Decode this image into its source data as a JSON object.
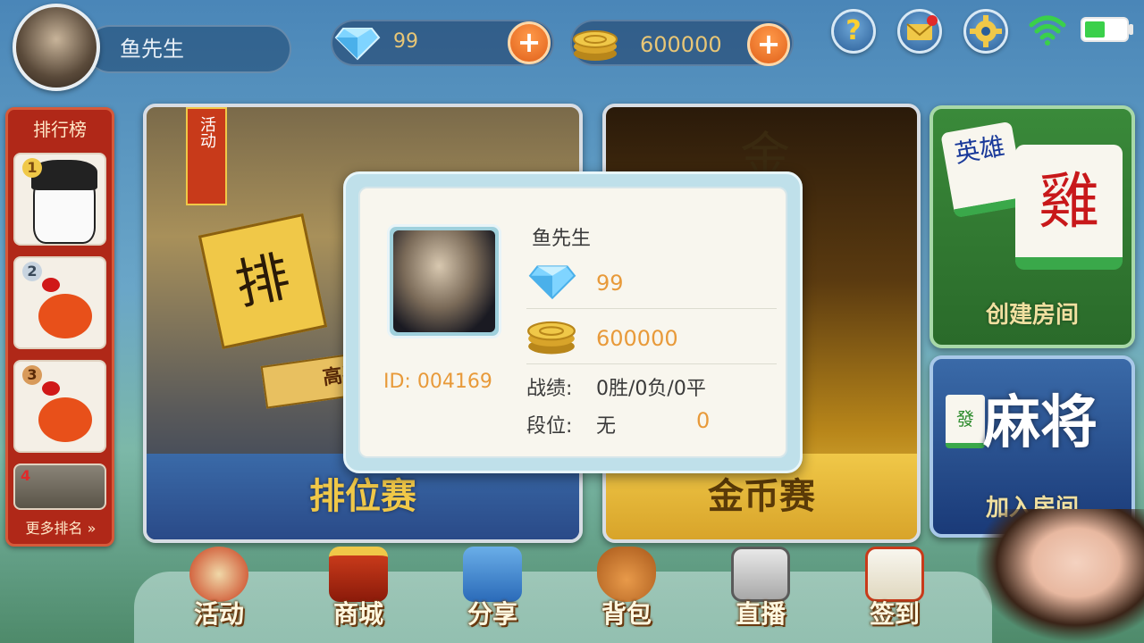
{
  "header": {
    "player_name": "鱼先生",
    "diamonds": "99",
    "coins": "600000",
    "plus_label": "+",
    "help_label": "?"
  },
  "ranking": {
    "title": "排行榜",
    "ranks": [
      "1",
      "2",
      "3",
      "4"
    ],
    "more_label": "更多排名 »"
  },
  "cards": {
    "ranked": {
      "label": "排位赛",
      "activity_tag": "活动",
      "banner": "高手竞",
      "tile_char": "排"
    },
    "gold": {
      "label": "金币赛",
      "big_char": "金"
    },
    "create_room": {
      "label": "创建房间",
      "tile1": "英雄",
      "tile2": "雞"
    },
    "join_room": {
      "label": "加入房间",
      "title": "麻将",
      "tile": "發"
    }
  },
  "profile_popup": {
    "name": "鱼先生",
    "id_text": "ID: 004169",
    "diamonds": "99",
    "coins": "600000",
    "record_label": "战绩:",
    "record_value": "0胜/0负/0平",
    "rank_label": "段位:",
    "rank_value": "无",
    "rank_points": "0"
  },
  "bottom_nav": {
    "items": [
      {
        "label": "活动",
        "icon": "drum-icon"
      },
      {
        "label": "商城",
        "icon": "shop-icon"
      },
      {
        "label": "分享",
        "icon": "share-icon"
      },
      {
        "label": "背包",
        "icon": "bag-icon"
      },
      {
        "label": "直播",
        "icon": "live-icon"
      },
      {
        "label": "签到",
        "icon": "checkin-icon"
      }
    ]
  },
  "colors": {
    "accent_gold": "#e89a3a",
    "plus_orange": "#e0601a",
    "rank_red": "#b02818"
  }
}
